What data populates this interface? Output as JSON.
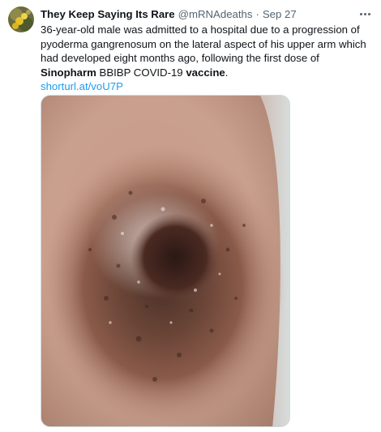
{
  "tweet": {
    "author_name": "They Keep Saying Its Rare",
    "handle": "@mRNAdeaths",
    "separator": "·",
    "date": "Sep 27",
    "text_part1": "36-year-old male was admitted to a hospital due to a progression of pyoderma gangrenosum on the lateral aspect of his upper arm which had developed eight months ago, following the first dose of ",
    "bold1": "Sinopharm",
    "text_part2": " BBIBP COVID-19 ",
    "bold2": "vaccine",
    "text_part3": ".",
    "link": "shorturl.at/voU7P"
  },
  "colors": {
    "text": "#0f1419",
    "secondary": "#536471",
    "link": "#1d9bf0",
    "border": "#cfd9de"
  },
  "icons": {
    "more": "more-horizontal-icon",
    "avatar": "profile-avatar"
  }
}
